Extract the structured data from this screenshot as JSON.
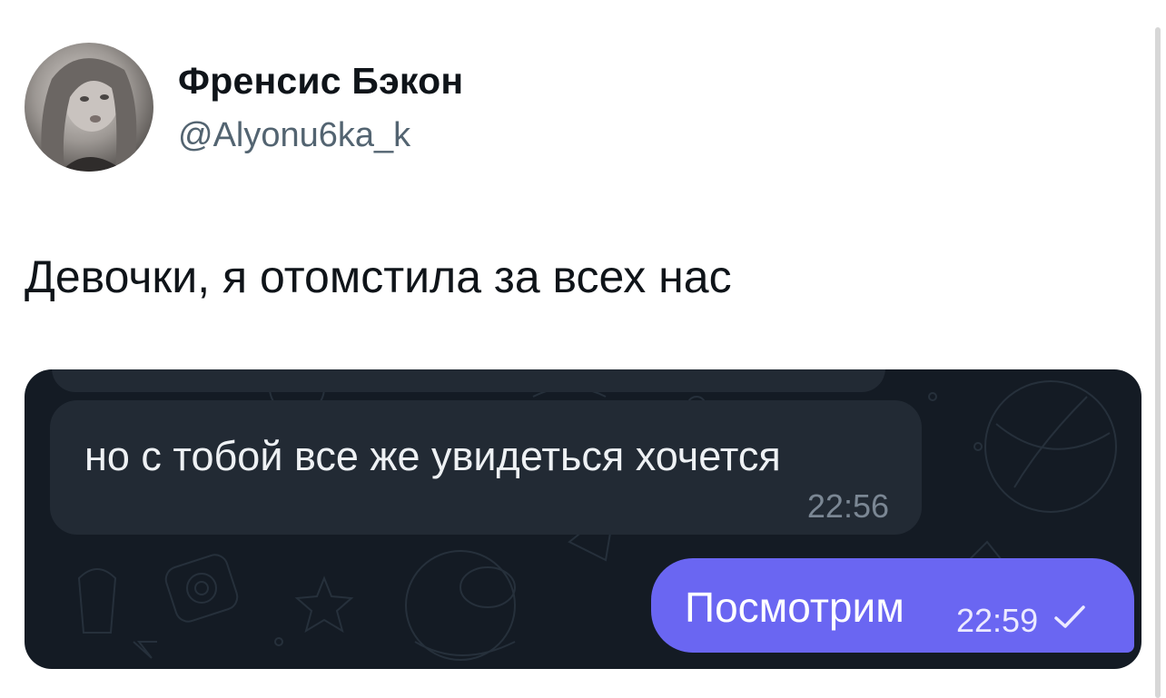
{
  "tweet": {
    "author": {
      "display_name": "Френсис Бэкон",
      "handle": "@Alyonu6ka_k"
    },
    "text": "Девочки, я отомстила за всех нас"
  },
  "chat": {
    "incoming_message": {
      "text": "но с тобой все же увидеться хочется",
      "time": "22:56"
    },
    "outgoing_message": {
      "text": "Посмотрим",
      "time": "22:59",
      "status_icon": "single-check-icon"
    }
  },
  "colors": {
    "chat_background": "#141b24",
    "incoming_bubble": "#222a34",
    "outgoing_bubble": "#6a66f2",
    "handle_text": "#536471"
  }
}
